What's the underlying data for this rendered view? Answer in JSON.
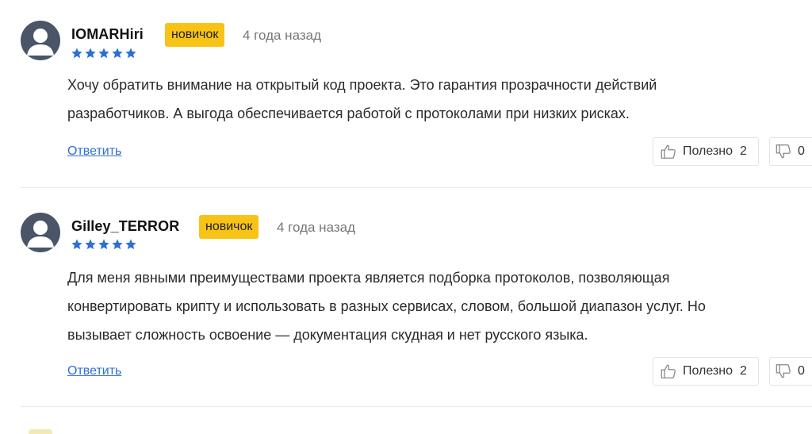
{
  "comments": [
    {
      "author": "IOMARHiri",
      "badge": "новичок",
      "time": "4 года назад",
      "rating": 5,
      "text_line1": "Хочу обратить внимание на открытый код проекта. Это гарантия прозрачности действий",
      "text_line2": "разработчиков. А выгода обеспечивается работой с протоколами при низких рисках.",
      "reply_label": "Ответить",
      "helpful_label": "Полезно",
      "helpful_count": "2",
      "unhelpful_count": "0"
    },
    {
      "author": "Gilley_TERROR",
      "badge": "новичок",
      "time": "4 года назад",
      "rating": 5,
      "text_line1": "Для меня явными преимуществами проекта является подборка протоколов, позволяющая",
      "text_line2": "конвертировать крипту и использовать в разных сервисах, словом, большой диапазон услуг. Но",
      "text_line3": "вызывает сложность освоение — документация скудная и нет русского языка.",
      "reply_label": "Ответить",
      "helpful_label": "Полезно",
      "helpful_count": "2",
      "unhelpful_count": "0"
    }
  ],
  "colors": {
    "badge": "#f7c316",
    "star": "#2c6fd6",
    "link": "#2c6fd6",
    "avatar": "#4a5568"
  },
  "icons": {
    "avatar": "user-avatar-icon",
    "star": "star-icon",
    "like": "thumbs-up-icon",
    "dislike": "thumbs-down-icon"
  }
}
